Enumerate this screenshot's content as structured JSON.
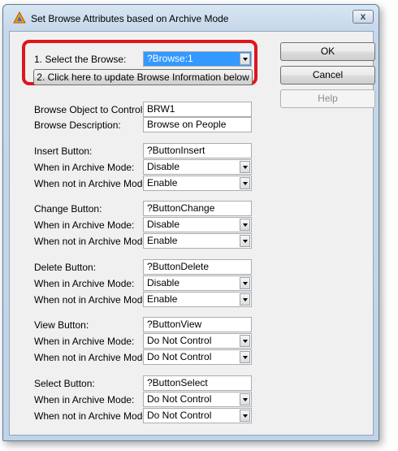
{
  "window": {
    "title": "Set Browse Attributes based on Archive Mode",
    "close_glyph": "x"
  },
  "select_browse": {
    "label": "1. Select the Browse:",
    "value": "?Browse:1"
  },
  "update_button": "2. Click here to update Browse Information below",
  "buttons": {
    "ok": "OK",
    "cancel": "Cancel",
    "help": "Help"
  },
  "browse_object": {
    "label": "Browse Object to Control:",
    "value": "BRW1"
  },
  "browse_description": {
    "label": "Browse Description:",
    "value": "Browse on People"
  },
  "archive_labels": {
    "in": "When in Archive Mode:",
    "not_in": "When not in Archive Mode:"
  },
  "groups": [
    {
      "label": "Insert Button:",
      "control": "?ButtonInsert",
      "in_mode": "Disable",
      "not_in_mode": "Enable"
    },
    {
      "label": "Change Button:",
      "control": "?ButtonChange",
      "in_mode": "Disable",
      "not_in_mode": "Enable"
    },
    {
      "label": "Delete Button:",
      "control": "?ButtonDelete",
      "in_mode": "Disable",
      "not_in_mode": "Enable"
    },
    {
      "label": "View Button:",
      "control": "?ButtonView",
      "in_mode": "Do Not Control",
      "not_in_mode": "Do Not Control"
    },
    {
      "label": "Select Button:",
      "control": "?ButtonSelect",
      "in_mode": "Do Not Control",
      "not_in_mode": "Do Not Control"
    }
  ],
  "colors": {
    "highlight": "#e0141e",
    "selection": "#3399ff"
  }
}
